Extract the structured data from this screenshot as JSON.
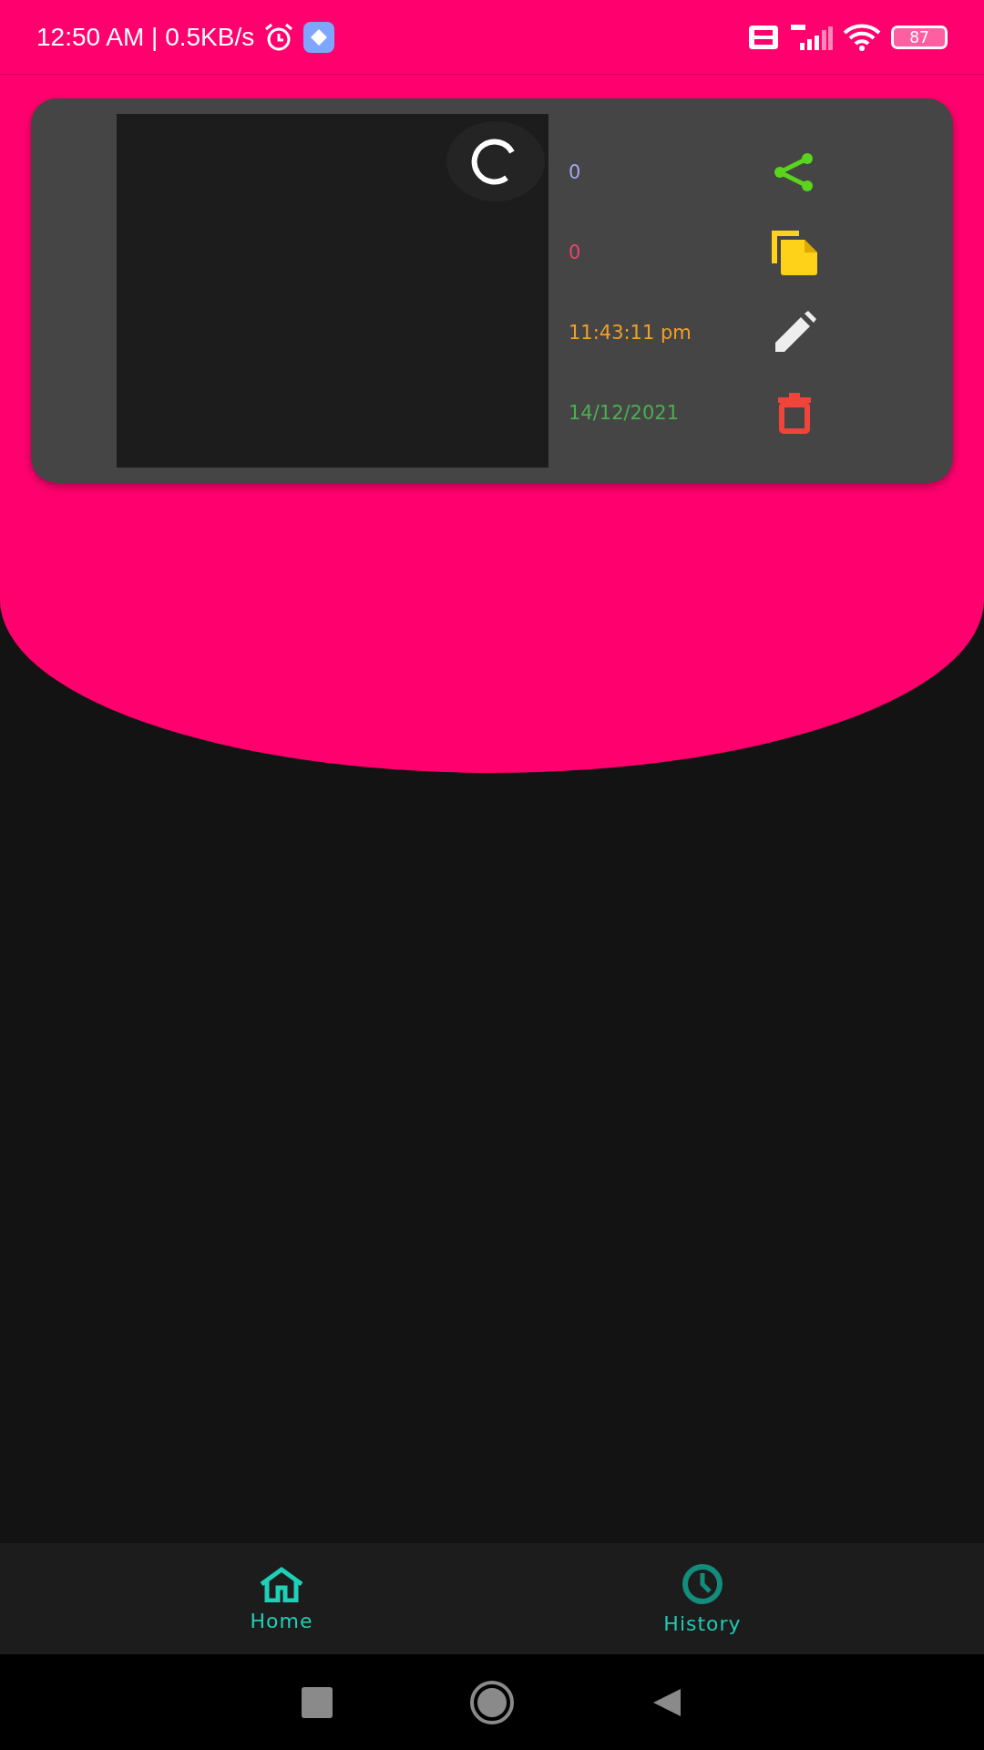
{
  "status_bar": {
    "time": "12:50 AM | 0.5KB/s",
    "battery": "87"
  },
  "card": {
    "rows": [
      {
        "value": "0",
        "color": "#a3a8f0",
        "kind": "share"
      },
      {
        "value": "0",
        "color": "#e8456a",
        "kind": "copy"
      },
      {
        "value": "11:43:11 pm",
        "color": "#f0a028",
        "kind": "edit"
      },
      {
        "value": "14/12/2021",
        "color": "#4caf50",
        "kind": "delete"
      }
    ]
  },
  "bottom_nav": [
    {
      "label": "Home",
      "kind": "home",
      "selected": true
    },
    {
      "label": "History",
      "kind": "history",
      "selected": false
    }
  ]
}
